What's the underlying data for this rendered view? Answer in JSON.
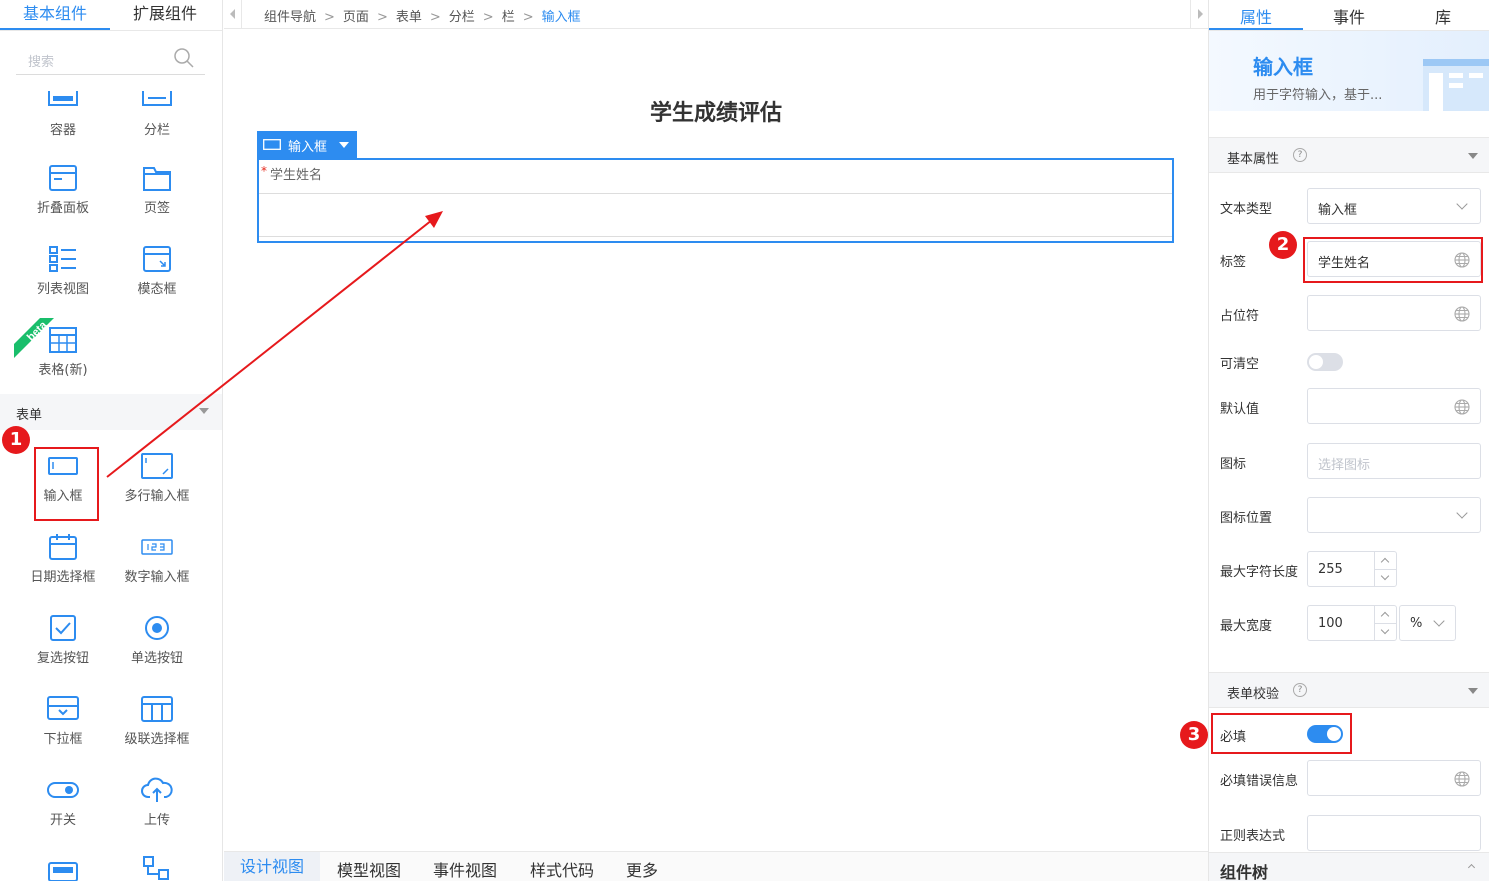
{
  "left_panel": {
    "tabs": [
      "基本组件",
      "扩展组件"
    ],
    "search_placeholder": "搜索",
    "layout_items": [
      "容器",
      "分栏",
      "折叠面板",
      "页签",
      "列表视图",
      "模态框",
      "表格(新)"
    ],
    "beta_label": "beta",
    "form_section_title": "表单",
    "form_items": [
      "输入框",
      "多行输入框",
      "日期选择框",
      "数字输入框",
      "复选按钮",
      "单选按钮",
      "下拉框",
      "级联选择框",
      "开关",
      "上传"
    ]
  },
  "breadcrumb": [
    "组件导航",
    "页面",
    "表单",
    "分栏",
    "栏",
    "输入框"
  ],
  "canvas": {
    "page_title": "学生成绩评估",
    "selected_component_tag": "输入框",
    "field_required_mark": "*",
    "field_label": "学生姓名"
  },
  "bottom_tabs": [
    "设计视图",
    "模型视图",
    "事件视图",
    "样式代码",
    "更多"
  ],
  "right_panel": {
    "tabs": [
      "属性",
      "事件",
      "库"
    ],
    "component_title": "输入框",
    "component_desc": "用于字符输入，基于...",
    "basic_section": "基本属性",
    "help_mark": "?",
    "props": {
      "text_type": {
        "label": "文本类型",
        "value": "输入框"
      },
      "tag": {
        "label": "标签",
        "value": "学生姓名"
      },
      "placeholder": {
        "label": "占位符",
        "value": ""
      },
      "clearable": {
        "label": "可清空",
        "on": false
      },
      "default_value": {
        "label": "默认值",
        "value": ""
      },
      "icon": {
        "label": "图标",
        "placeholder": "选择图标"
      },
      "icon_position": {
        "label": "图标位置",
        "value": ""
      },
      "max_length": {
        "label": "最大字符长度",
        "value": "255"
      },
      "max_width": {
        "label": "最大宽度",
        "value": "100",
        "unit": "%"
      }
    },
    "validation_section": "表单校验",
    "validation": {
      "required": {
        "label": "必填",
        "on": true
      },
      "required_error": {
        "label": "必填错误信息",
        "value": ""
      },
      "regex": {
        "label": "正则表达式",
        "value": ""
      }
    },
    "tree_title": "组件树"
  },
  "annotations": [
    "1",
    "2",
    "3"
  ],
  "colors": {
    "accent": "#2d8cf0",
    "annotation": "#e6191c"
  }
}
